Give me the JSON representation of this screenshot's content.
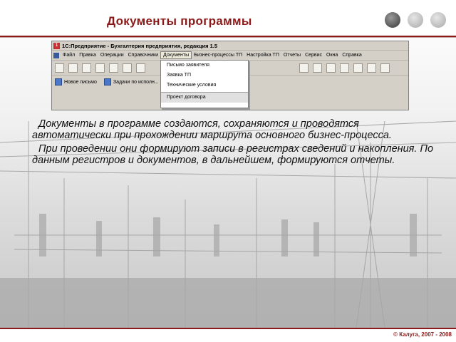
{
  "slide": {
    "title": "Документы программы",
    "paragraphs": [
      "Документы в программе создаются, сохраняются и проводятся автоматически при прохождении маршрута основного бизнес-процесса.",
      "При проведении они формируют записи в регистрах сведений и накопления. По данным регистров и документов, в дальнейшем, формируются отчеты."
    ],
    "footer": "© Калуга, 2007 - 2008"
  },
  "app": {
    "window_title": "1С:Предприятие - Бухгалтерия предприятия, редакция 1.5",
    "menu": [
      "Файл",
      "Правка",
      "Операции",
      "Справочники",
      "Документы",
      "Бизнес-процессы ТП",
      "Настройка ТП",
      "Отчеты",
      "Сервис",
      "Окна",
      "Справка"
    ],
    "active_menu": "Документы",
    "toolbar2": [
      "Новое письмо",
      "Задачи по исполн..."
    ],
    "dropdown": [
      "Письмо заявителя",
      "Заявка ТП",
      "Технические условия",
      "Проект договора"
    ],
    "dropdown_selected": "Проект договора"
  },
  "colors": {
    "accent": "#8a1a1a",
    "app_chrome": "#d4d0c8"
  }
}
